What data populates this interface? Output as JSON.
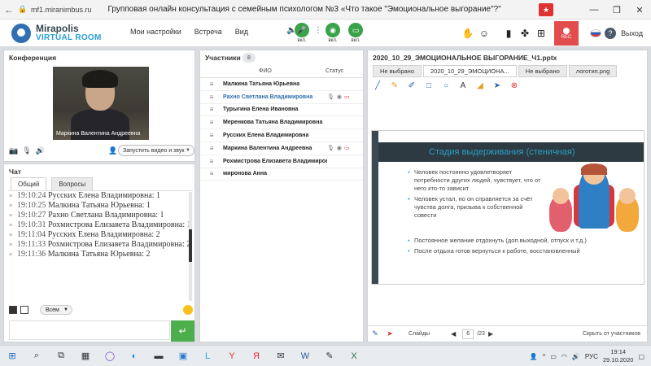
{
  "browser": {
    "url": "mf1.miranimbus.ru",
    "title": "Групповая онлайн консультация с семейным психологом №3 «Что такое \"Эмоциональное выгорание\"?\""
  },
  "header": {
    "logo_name": "Mirapolis",
    "logo_sub": "VIRTUAL ROOM",
    "nav": [
      "Мои настройки",
      "Встреча",
      "Вид"
    ],
    "mic_label": "вкл.",
    "cam_label": "вкл.",
    "screen_label": "вкл.",
    "rec_label": "REC",
    "exit_label": "Выход",
    "help_label": "?"
  },
  "conference": {
    "title": "Конференция",
    "video_name": "Маркина Валентина  Андреевна",
    "video_dropdown": "Запустить видео и звук"
  },
  "chat": {
    "title": "Чат",
    "tabs": [
      "Общий",
      "Вопросы"
    ],
    "messages": [
      {
        "time": "19:10:24",
        "text": "Русских Елена Владимировна: 1"
      },
      {
        "time": "19:10:25",
        "text": "Малкина Татьяна  Юрьевна: 1"
      },
      {
        "time": "19:10:27",
        "text": "Рахно Светлана  Владимировна: 1"
      },
      {
        "time": "19:10:31",
        "text": "Рохмистрова  Елизавета Владимировна: 1"
      },
      {
        "time": "19:11:04",
        "text": "Русских Елена Владимировна: 2"
      },
      {
        "time": "19:11:33",
        "text": "Рохмистрова  Елизавета Владимировна: 2"
      },
      {
        "time": "19:11:36",
        "text": "Малкина Татьяна  Юрьевна: 2"
      }
    ],
    "recipient": "Всем"
  },
  "participants": {
    "title": "Участники",
    "count": "8",
    "col_name": "ФИО",
    "col_status": "Статус",
    "rows": [
      "Малкина Татьяна  Юрьевна",
      "Рахно Светлана  Владимировна",
      "Турыгина  Елена  Ивановна",
      "Меренкова  Татьяна  Владимировна",
      "Русских Елена Владимировна",
      "Маркина Валентина  Андреевна",
      "Рохмистрова  Елизавета Владимировна",
      "миронова  Анна"
    ]
  },
  "presentation": {
    "title": "2020_10_29_ЭМОЦИОНАЛЬНОЕ ВЫГОРАНИЕ_Ч1.pptx",
    "tabs": [
      "Не выбрано",
      "2020_10_29_ЭМОЦИОНА...",
      "Не выбрано",
      "логотип.png"
    ],
    "slide_title": "Стадия выдерживания (стеничная)",
    "bullets": [
      "Человек постоянно удовлетворяет потребности других людей, чувствует, что от него кто-то зависит",
      "Человек устал, но он справляется за счёт чувства долга, призыва к собственной совести"
    ],
    "bullets2": [
      "Постоянное желание отдохнуть (доп.выходной, отпуск и т.д.)",
      "После отдыха готов вернуться к работе, восстановленный"
    ],
    "slides_label": "Слайды",
    "page": "6",
    "total": "/23",
    "hide_label": "Скрыть от участников"
  },
  "taskbar": {
    "lang": "РУС",
    "time": "19:14",
    "date": "29.10.2020"
  },
  "colors": {
    "accent_blue": "#2a9fd6",
    "green": "#3aa34a",
    "rec_red": "#e24c4c",
    "slide_dark": "#2e3a42"
  }
}
